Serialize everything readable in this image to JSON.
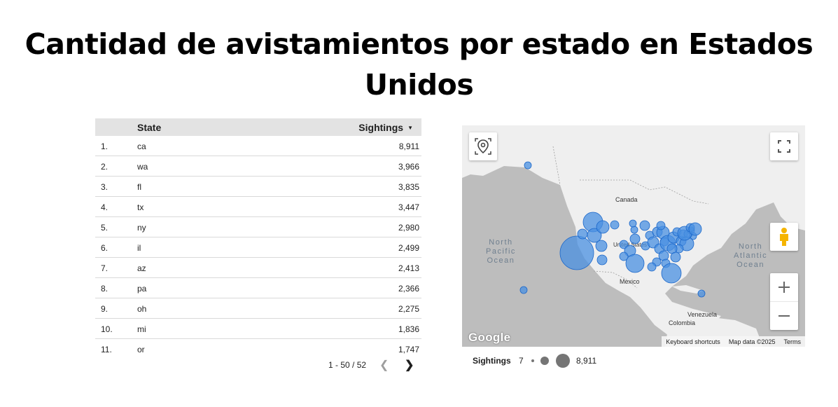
{
  "title": "Cantidad de avistamientos por estado en Estados Unidos",
  "table": {
    "columns": {
      "state": "State",
      "sightings": "Sightings"
    },
    "sort_icon": "sort-descending-icon",
    "rows": [
      {
        "idx": "1.",
        "state": "ca",
        "value": "8,911"
      },
      {
        "idx": "2.",
        "state": "wa",
        "value": "3,966"
      },
      {
        "idx": "3.",
        "state": "fl",
        "value": "3,835"
      },
      {
        "idx": "4.",
        "state": "tx",
        "value": "3,447"
      },
      {
        "idx": "5.",
        "state": "ny",
        "value": "2,980"
      },
      {
        "idx": "6.",
        "state": "il",
        "value": "2,499"
      },
      {
        "idx": "7.",
        "state": "az",
        "value": "2,413"
      },
      {
        "idx": "8.",
        "state": "pa",
        "value": "2,366"
      },
      {
        "idx": "9.",
        "state": "oh",
        "value": "2,275"
      },
      {
        "idx": "10.",
        "state": "mi",
        "value": "1,836"
      },
      {
        "idx": "11.",
        "state": "or",
        "value": "1,747"
      }
    ]
  },
  "pager": {
    "range": "1 - 50 / 52",
    "prev_icon": "chevron-left-icon",
    "next_icon": "chevron-right-icon"
  },
  "map": {
    "labels": {
      "canada": "Canada",
      "united_states": "United States",
      "mexico": "Mexico",
      "north_pacific": [
        "North",
        "Pacific",
        "Ocean"
      ],
      "north_atlantic": [
        "North",
        "Atlantic",
        "Ocean"
      ],
      "venezuela": "Venezuela",
      "colombia": "Colombia"
    },
    "attribution": {
      "shortcuts": "Keyboard shortcuts",
      "map_data": "Map data ©2025",
      "terms": "Terms"
    },
    "logo": "Google",
    "bubble_color": "#4a90e2",
    "controls": [
      "location-pin-icon",
      "fullscreen-icon",
      "pegman-icon",
      "zoom-in-icon",
      "zoom-out-icon"
    ]
  },
  "legend": {
    "label": "Sightings",
    "min": "7",
    "max": "8,911"
  }
}
